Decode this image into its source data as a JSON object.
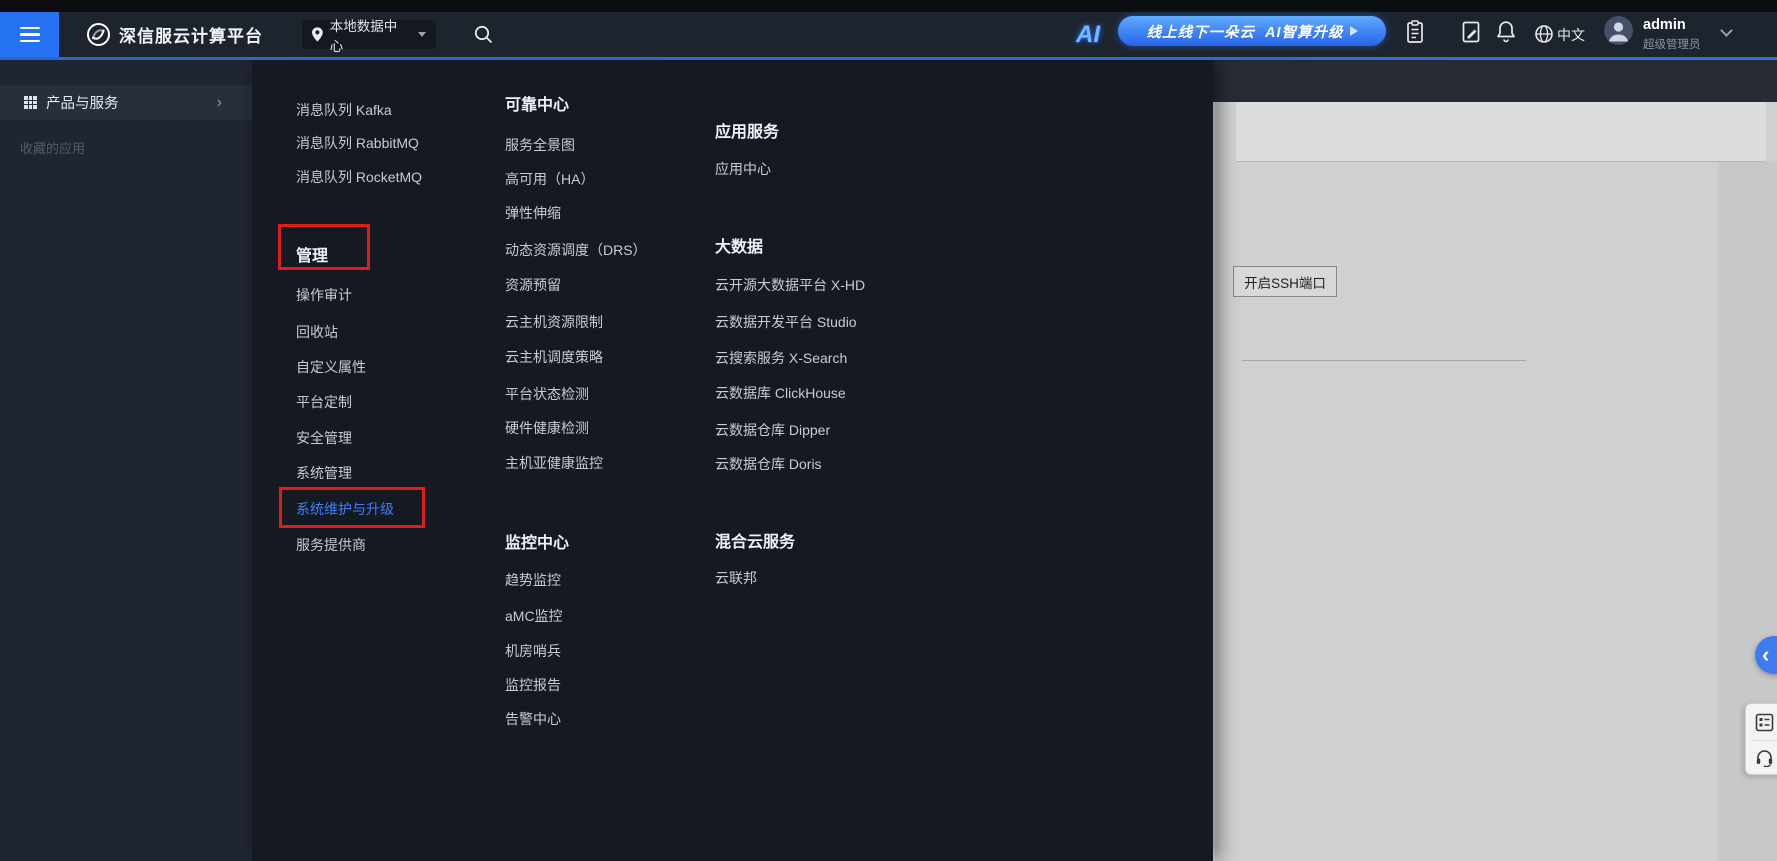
{
  "header": {
    "brand": "深信服云计算平台",
    "datacenter": "本地数据中心",
    "ai_banner": {
      "logo": "AI",
      "text": "线上线下一朵云  AI智算升级"
    },
    "language": "中文",
    "user": {
      "name": "admin",
      "role": "超级管理员"
    },
    "icons": [
      "hamburger-menu-icon",
      "brand-logo-icon",
      "location-pin-icon",
      "search-icon",
      "clipboard-icon",
      "file-edit-icon",
      "bell-icon",
      "globe-icon",
      "user-avatar",
      "chevron-down-icon"
    ]
  },
  "sidebar": {
    "products": "产品与服务",
    "favorites": "收藏的应用",
    "icons": [
      "app-grid-icon",
      "chevron-right-icon"
    ]
  },
  "menu": {
    "columns": [
      {
        "groups": [
          {
            "header": "",
            "items": [
              {
                "label": "消息队列 Kafka"
              },
              {
                "label": "消息队列 RabbitMQ"
              },
              {
                "label": "消息队列 RocketMQ"
              }
            ]
          },
          {
            "header": "管理",
            "annotated": true,
            "items": [
              {
                "label": "操作审计"
              },
              {
                "label": "回收站"
              },
              {
                "label": "自定义属性"
              },
              {
                "label": "平台定制"
              },
              {
                "label": "安全管理"
              },
              {
                "label": "系统管理"
              },
              {
                "label": "系统维护与升级",
                "active": true,
                "annotated": true
              },
              {
                "label": "服务提供商"
              }
            ]
          }
        ]
      },
      {
        "groups": [
          {
            "header": "可靠中心",
            "items": [
              {
                "label": "服务全景图"
              },
              {
                "label": "高可用（HA）"
              },
              {
                "label": "弹性伸缩"
              },
              {
                "label": "动态资源调度（DRS）"
              },
              {
                "label": "资源预留"
              },
              {
                "label": "云主机资源限制"
              },
              {
                "label": "云主机调度策略"
              },
              {
                "label": "平台状态检测"
              },
              {
                "label": "硬件健康检测"
              },
              {
                "label": "主机亚健康监控"
              }
            ]
          },
          {
            "header": "监控中心",
            "items": [
              {
                "label": "趋势监控"
              },
              {
                "label": "aMC监控"
              },
              {
                "label": "机房哨兵"
              },
              {
                "label": "监控报告"
              },
              {
                "label": "告警中心"
              }
            ]
          }
        ]
      },
      {
        "groups": [
          {
            "header": "应用服务",
            "items": [
              {
                "label": "应用中心"
              }
            ]
          },
          {
            "header": "大数据",
            "items": [
              {
                "label": "云开源大数据平台 X-HD"
              },
              {
                "label": "云数据开发平台 Studio"
              },
              {
                "label": "云搜索服务 X-Search"
              },
              {
                "label": "云数据库 ClickHouse"
              },
              {
                "label": "云数据仓库 Dipper"
              },
              {
                "label": "云数据仓库 Doris"
              }
            ]
          },
          {
            "header": "混合云服务",
            "items": [
              {
                "label": "云联邦"
              }
            ]
          }
        ]
      }
    ]
  },
  "page": {
    "ssh_button": "开启SSH端口"
  },
  "widgets": {
    "collapse_chevron": "‹",
    "icons": [
      "survey-form-icon",
      "headset-support-icon"
    ]
  },
  "colors": {
    "accent_blue": "#2573f2",
    "active_link": "#3e7eff",
    "annotation_red": "#e11c1c",
    "banner_gradient_start": "#5fabff",
    "banner_gradient_end": "#2563e8",
    "header_bg": "#1d242e",
    "menu_bg": "#151a22",
    "page_bg": "#cfd0d2"
  }
}
